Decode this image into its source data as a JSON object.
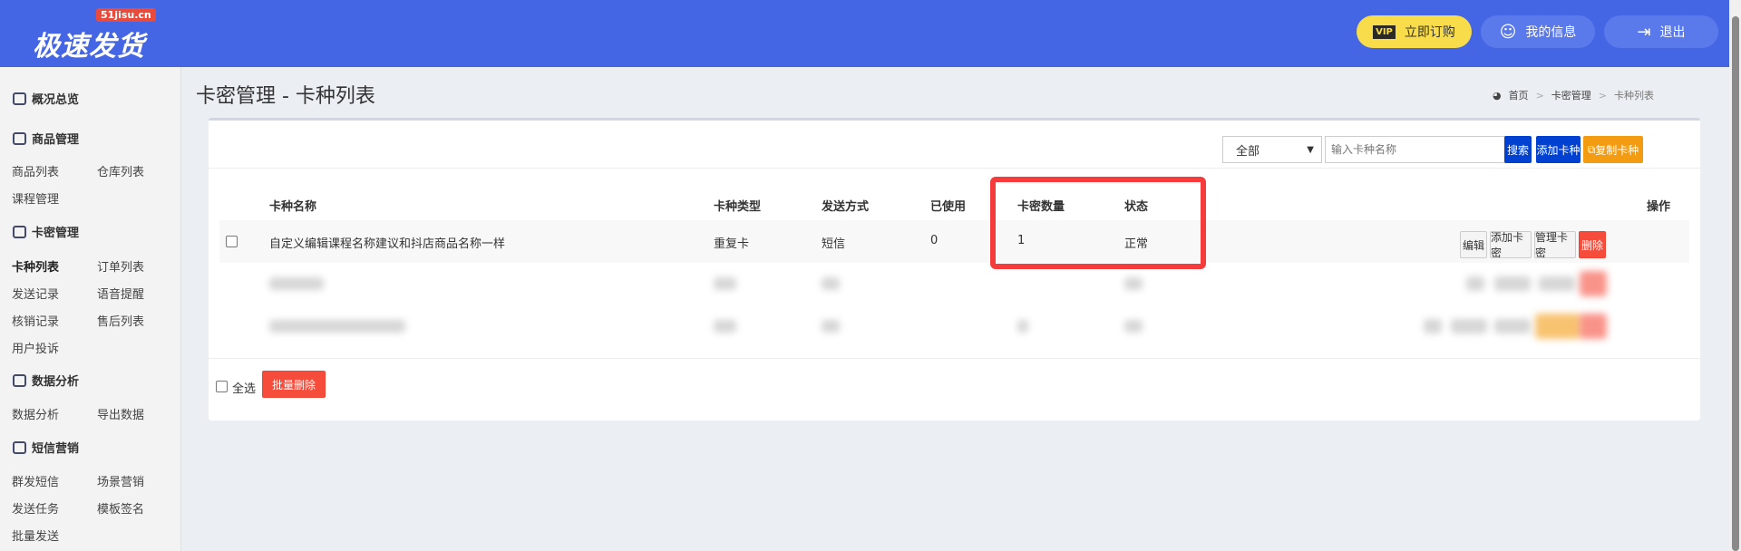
{
  "header": {
    "logo": "极速发货",
    "logo_badge": "51jisu.cn",
    "vip_icon": "VIP",
    "order_label": "立即订购",
    "profile_label": "我的信息",
    "logout_label": "退出"
  },
  "sidebar": {
    "overview": "概况总览",
    "goods": {
      "title": "商品管理",
      "items": [
        "商品列表",
        "仓库列表",
        "课程管理"
      ]
    },
    "cards": {
      "title": "卡密管理",
      "items": [
        "卡种列表",
        "订单列表",
        "发送记录",
        "语音提醒",
        "核销记录",
        "售后列表",
        "用户投诉"
      ]
    },
    "analysis": {
      "title": "数据分析",
      "items": [
        "数据分析",
        "导出数据"
      ]
    },
    "sms": {
      "title": "短信营销",
      "items": [
        "群发短信",
        "场景营销",
        "发送任务",
        "模板签名",
        "批量发送"
      ]
    }
  },
  "page": {
    "title": "卡密管理 - 卡种列表",
    "breadcrumb": [
      "首页",
      "卡密管理",
      "卡种列表"
    ]
  },
  "toolbar": {
    "filter_value": "全部",
    "search_placeholder": "输入卡种名称",
    "search_label": "搜索",
    "add_label": "添加卡种",
    "copy_label": "复制卡种"
  },
  "table": {
    "headers": [
      "卡种名称",
      "卡种类型",
      "发送方式",
      "已使用",
      "卡密数量",
      "状态",
      "操作"
    ],
    "rows": [
      {
        "name": "自定义编辑课程名称建议和抖店商品名称一样",
        "type": "重复卡",
        "send": "短信",
        "used": "0",
        "count": "1",
        "status": "正常"
      }
    ],
    "actions": [
      "编辑",
      "添加卡密",
      "管理卡密",
      "删除"
    ]
  },
  "footer": {
    "select_all": "全选",
    "batch_delete": "批量删除"
  },
  "colors": {
    "header": "#4466e4",
    "primary": "#0041d1",
    "warning": "#f39c12",
    "danger": "#f54c3c",
    "highlight": "#f53b3b"
  }
}
